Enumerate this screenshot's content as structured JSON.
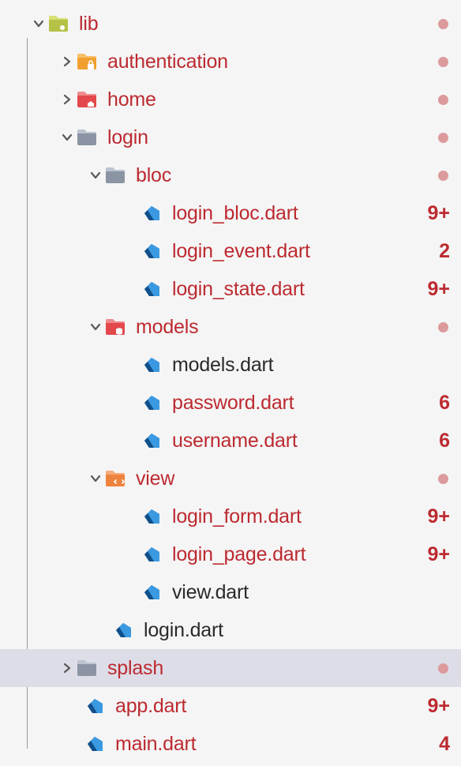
{
  "colors": {
    "modified_text": "#bc2a30",
    "plain_text": "#2a2a2a",
    "dot": "#dc9a9d",
    "selected_bg": "#dddde8"
  },
  "rows": [
    {
      "indent": 0,
      "arrow": "down",
      "icon": "folder-lib",
      "label": "lib",
      "modified": true,
      "badge_type": "dot",
      "badge": ""
    },
    {
      "indent": 1,
      "arrow": "right",
      "icon": "folder-auth",
      "label": "authentication",
      "modified": true,
      "badge_type": "dot",
      "badge": ""
    },
    {
      "indent": 1,
      "arrow": "right",
      "icon": "folder-home",
      "label": "home",
      "modified": true,
      "badge_type": "dot",
      "badge": ""
    },
    {
      "indent": 1,
      "arrow": "down",
      "icon": "folder-grey",
      "label": "login",
      "modified": true,
      "badge_type": "dot",
      "badge": ""
    },
    {
      "indent": 2,
      "arrow": "down",
      "icon": "folder-grey",
      "label": "bloc",
      "modified": true,
      "badge_type": "dot",
      "badge": ""
    },
    {
      "indent": 3,
      "arrow": "none",
      "icon": "dart",
      "label": "login_bloc.dart",
      "modified": true,
      "badge_type": "text",
      "badge": "9+"
    },
    {
      "indent": 3,
      "arrow": "none",
      "icon": "dart",
      "label": "login_event.dart",
      "modified": true,
      "badge_type": "text",
      "badge": "2"
    },
    {
      "indent": 3,
      "arrow": "none",
      "icon": "dart",
      "label": "login_state.dart",
      "modified": true,
      "badge_type": "text",
      "badge": "9+"
    },
    {
      "indent": 2,
      "arrow": "down",
      "icon": "folder-models",
      "label": "models",
      "modified": true,
      "badge_type": "dot",
      "badge": ""
    },
    {
      "indent": 3,
      "arrow": "none",
      "icon": "dart",
      "label": "models.dart",
      "modified": false,
      "badge_type": "none",
      "badge": ""
    },
    {
      "indent": 3,
      "arrow": "none",
      "icon": "dart",
      "label": "password.dart",
      "modified": true,
      "badge_type": "text",
      "badge": "6"
    },
    {
      "indent": 3,
      "arrow": "none",
      "icon": "dart",
      "label": "username.dart",
      "modified": true,
      "badge_type": "text",
      "badge": "6"
    },
    {
      "indent": 2,
      "arrow": "down",
      "icon": "folder-view",
      "label": "view",
      "modified": true,
      "badge_type": "dot",
      "badge": ""
    },
    {
      "indent": 3,
      "arrow": "none",
      "icon": "dart",
      "label": "login_form.dart",
      "modified": true,
      "badge_type": "text",
      "badge": "9+"
    },
    {
      "indent": 3,
      "arrow": "none",
      "icon": "dart",
      "label": "login_page.dart",
      "modified": true,
      "badge_type": "text",
      "badge": "9+"
    },
    {
      "indent": 3,
      "arrow": "none",
      "icon": "dart",
      "label": "view.dart",
      "modified": false,
      "badge_type": "none",
      "badge": ""
    },
    {
      "indent": 2,
      "arrow": "none",
      "icon": "dart",
      "label": "login.dart",
      "modified": false,
      "badge_type": "none",
      "badge": ""
    },
    {
      "indent": 1,
      "arrow": "right",
      "icon": "folder-grey",
      "label": "splash",
      "modified": true,
      "badge_type": "dot",
      "badge": "",
      "selected": true
    },
    {
      "indent": 1,
      "arrow": "none",
      "icon": "dart",
      "label": "app.dart",
      "modified": true,
      "badge_type": "text",
      "badge": "9+"
    },
    {
      "indent": 1,
      "arrow": "none",
      "icon": "dart",
      "label": "main.dart",
      "modified": true,
      "badge_type": "text",
      "badge": "4"
    }
  ]
}
